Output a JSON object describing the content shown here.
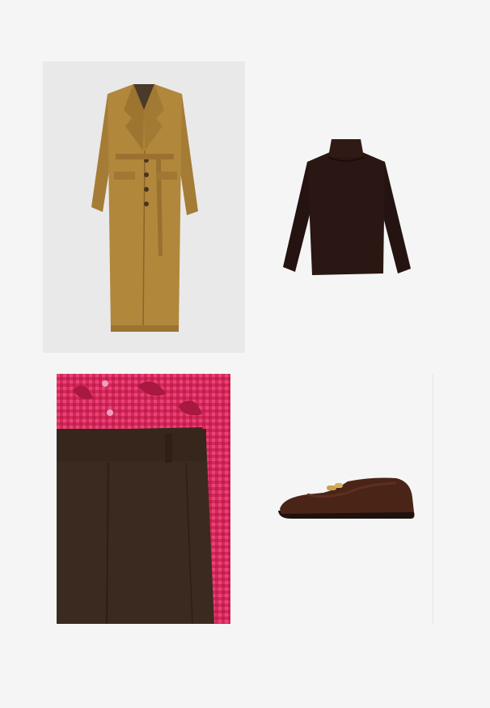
{
  "board": {
    "background": "#f5f5f5",
    "items": [
      {
        "id": "coat",
        "icon": "trench-coat-icon",
        "color": "#b1873c"
      },
      {
        "id": "sweater",
        "icon": "turtleneck-sweater-icon",
        "color": "#2a1612"
      },
      {
        "id": "pants",
        "icon": "trousers-icon",
        "color": "#3b2a1f",
        "accent": "#d6285a"
      },
      {
        "id": "shoe",
        "icon": "loafer-shoe-icon",
        "color": "#4b2418",
        "hardware": "#c9a14a"
      }
    ]
  }
}
